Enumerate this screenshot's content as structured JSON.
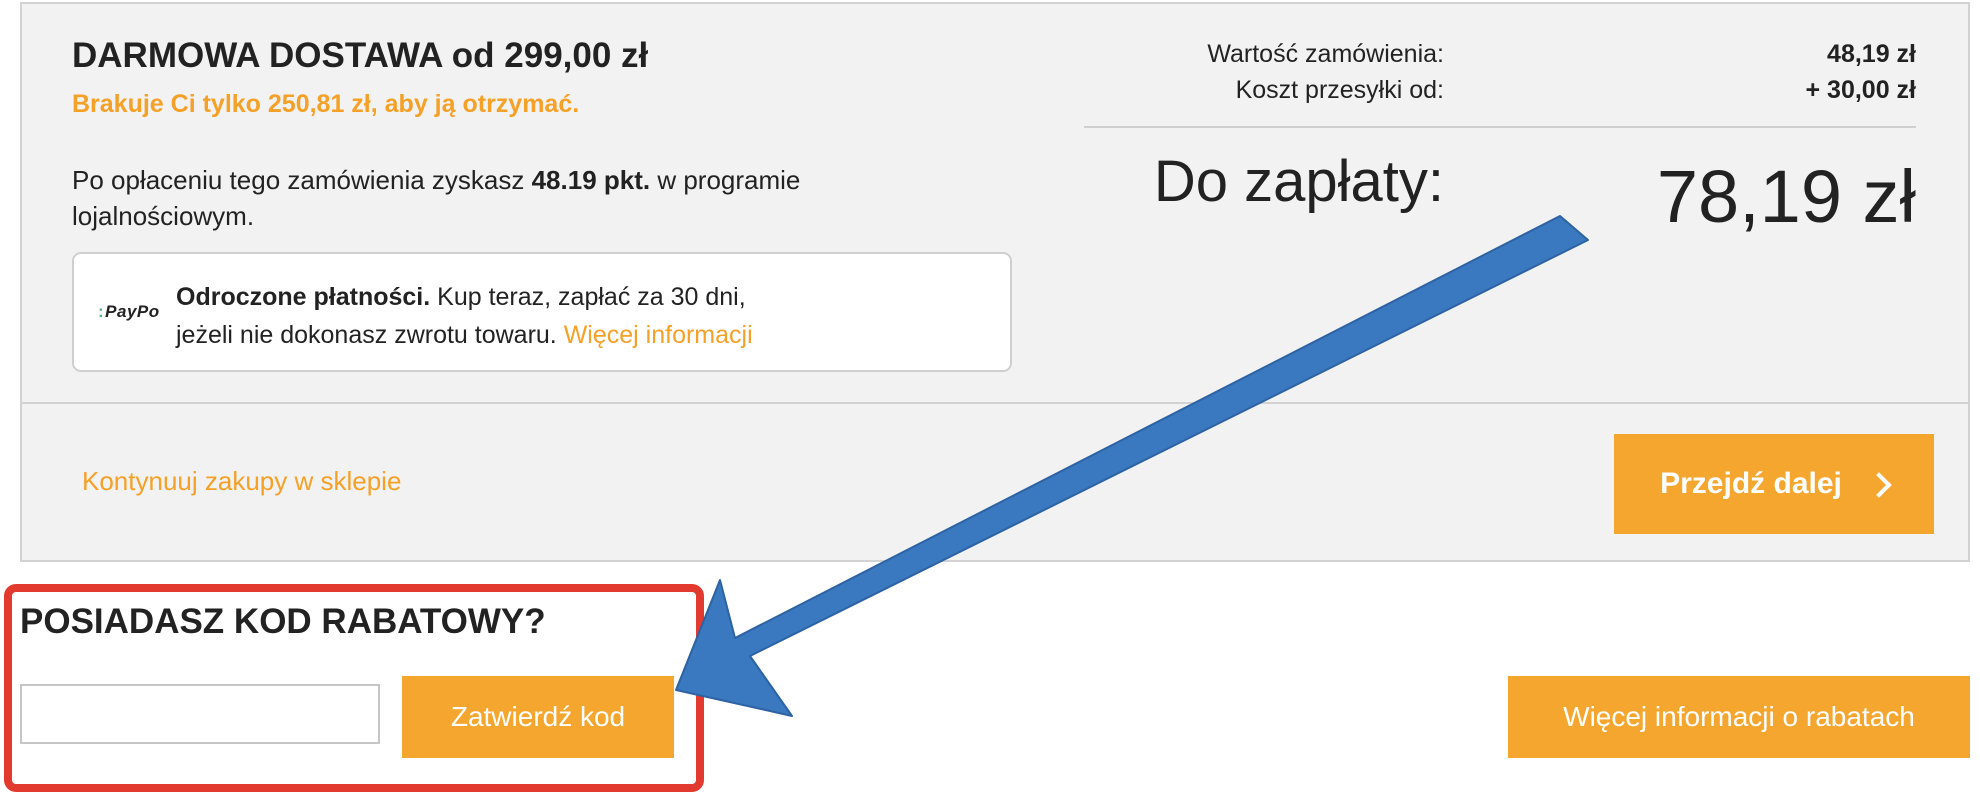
{
  "summary_panel": {
    "free_delivery_title": "DARMOWA DOSTAWA od 299,00 zł",
    "free_delivery_missing": "Brakuje Ci tylko 250,81 zł, aby ją otrzymać.",
    "loyalty_prefix": "Po opłaceniu tego zamówienia zyskasz ",
    "loyalty_points": "48.19 pkt.",
    "loyalty_suffix": " w programie lojalnościowym.",
    "paypo": {
      "logo": "PayPo",
      "title": "Odroczone płatności.",
      "text_line1": " Kup teraz, zapłać za 30 dni,",
      "text_line2": "jeżeli nie dokonasz zwrotu towaru. ",
      "link": "Więcej informacji"
    },
    "order_value_label": "Wartość zamówienia:",
    "order_value": "48,19 zł",
    "shipping_label": "Koszt przesyłki od:",
    "shipping_value": "+ 30,00 zł",
    "total_label": "Do zapłaty:",
    "total_value": "78,19 zł",
    "continue_link": "Kontynuuj zakupy w sklepie",
    "next_button": "Przejdź dalej"
  },
  "discount": {
    "title": "POSIADASZ KOD RABATOWY?",
    "code_value": "",
    "apply_button": "Zatwierdź kod",
    "info_button": "Więcej informacji o rabatach"
  },
  "colors": {
    "accent_orange": "#f5a62e",
    "highlight_red": "#e23a2e",
    "arrow_blue": "#3a78bf",
    "panel_bg": "#f2f2f2"
  }
}
